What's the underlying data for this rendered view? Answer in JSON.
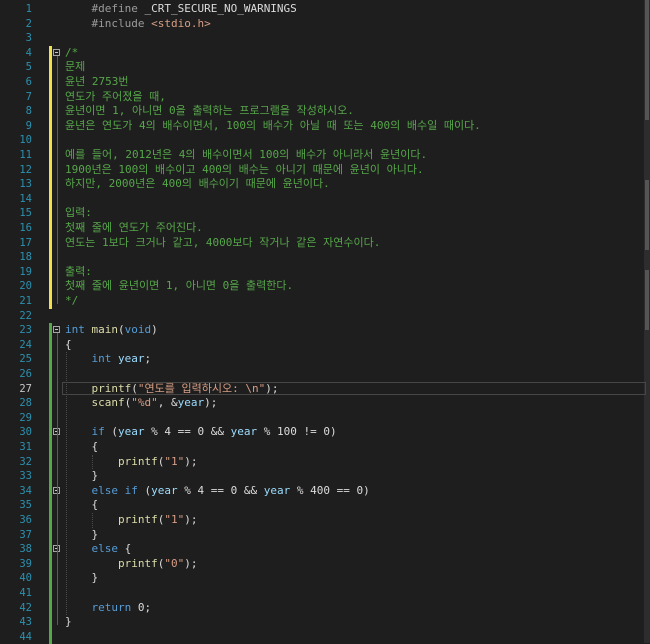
{
  "editor": {
    "current_line": 27,
    "lines": [
      {
        "n": "1",
        "text": "    #define _CRT_SECURE_NO_WARNINGS",
        "cls": "pp"
      },
      {
        "n": "2",
        "text": "    #include <stdio.h>",
        "cls": "pp"
      },
      {
        "n": "3",
        "text": "",
        "cls": ""
      },
      {
        "n": "4",
        "text": "/*",
        "cls": "cm"
      },
      {
        "n": "5",
        "text": "문제",
        "cls": "cm"
      },
      {
        "n": "6",
        "text": "윤년 2753번",
        "cls": "cm"
      },
      {
        "n": "7",
        "text": "연도가 주어졌을 때,",
        "cls": "cm"
      },
      {
        "n": "8",
        "text": "윤년이면 1, 아니면 0을 출력하는 프로그램을 작성하시오.",
        "cls": "cm"
      },
      {
        "n": "9",
        "text": "윤년은 연도가 4의 배수이면서, 100의 배수가 아닐 때 또는 400의 배수일 때이다.",
        "cls": "cm"
      },
      {
        "n": "10",
        "text": "",
        "cls": "cm"
      },
      {
        "n": "11",
        "text": "예를 들어, 2012년은 4의 배수이면서 100의 배수가 아니라서 윤년이다.",
        "cls": "cm"
      },
      {
        "n": "12",
        "text": "1900년은 100의 배수이고 400의 배수는 아니기 때문에 윤년이 아니다.",
        "cls": "cm"
      },
      {
        "n": "13",
        "text": "하지만, 2000년은 400의 배수이기 때문에 윤년이다.",
        "cls": "cm"
      },
      {
        "n": "14",
        "text": "",
        "cls": "cm"
      },
      {
        "n": "15",
        "text": "입력:",
        "cls": "cm"
      },
      {
        "n": "16",
        "text": "첫째 줄에 연도가 주어진다.",
        "cls": "cm"
      },
      {
        "n": "17",
        "text": "연도는 1보다 크거나 같고, 4000보다 작거나 같은 자연수이다.",
        "cls": "cm"
      },
      {
        "n": "18",
        "text": "",
        "cls": "cm"
      },
      {
        "n": "19",
        "text": "출력:",
        "cls": "cm"
      },
      {
        "n": "20",
        "text": "첫째 줄에 윤년이면 1, 아니면 0을 출력한다.",
        "cls": "cm"
      },
      {
        "n": "21",
        "text": "*/",
        "cls": "cm"
      },
      {
        "n": "22",
        "text": "",
        "cls": ""
      },
      {
        "n": "23",
        "text": "int main(void)",
        "cls": "main"
      },
      {
        "n": "24",
        "text": "{",
        "cls": ""
      },
      {
        "n": "25",
        "text": "    int year;",
        "cls": "decl"
      },
      {
        "n": "26",
        "text": "",
        "cls": ""
      },
      {
        "n": "27",
        "text": "    printf(\"연도를 입력하시오: \\n\");",
        "cls": "printf"
      },
      {
        "n": "28",
        "text": "    scanf(\"%d\", &year);",
        "cls": "scanf"
      },
      {
        "n": "29",
        "text": "",
        "cls": ""
      },
      {
        "n": "30",
        "text": "    if (year % 4 == 0 && year % 100 != 0)",
        "cls": "if1"
      },
      {
        "n": "31",
        "text": "    {",
        "cls": ""
      },
      {
        "n": "32",
        "text": "        printf(\"1\");",
        "cls": "p1"
      },
      {
        "n": "33",
        "text": "    }",
        "cls": ""
      },
      {
        "n": "34",
        "text": "    else if (year % 4 == 0 && year % 400 == 0)",
        "cls": "if2"
      },
      {
        "n": "35",
        "text": "    {",
        "cls": ""
      },
      {
        "n": "36",
        "text": "        printf(\"1\");",
        "cls": "p1"
      },
      {
        "n": "37",
        "text": "    }",
        "cls": ""
      },
      {
        "n": "38",
        "text": "    else {",
        "cls": "else"
      },
      {
        "n": "39",
        "text": "        printf(\"0\");",
        "cls": "p0"
      },
      {
        "n": "40",
        "text": "    }",
        "cls": ""
      },
      {
        "n": "41",
        "text": "",
        "cls": ""
      },
      {
        "n": "42",
        "text": "    return 0;",
        "cls": "ret"
      },
      {
        "n": "43",
        "text": "}",
        "cls": ""
      },
      {
        "n": "44",
        "text": "",
        "cls": ""
      }
    ]
  },
  "colors": {
    "background": "#1e1e1e",
    "line_number": "#2b91af",
    "comment": "#57a64a",
    "keyword": "#569cd6",
    "string": "#d69d85",
    "change_saved": "#57a64a",
    "change_unsaved": "#efe050"
  }
}
